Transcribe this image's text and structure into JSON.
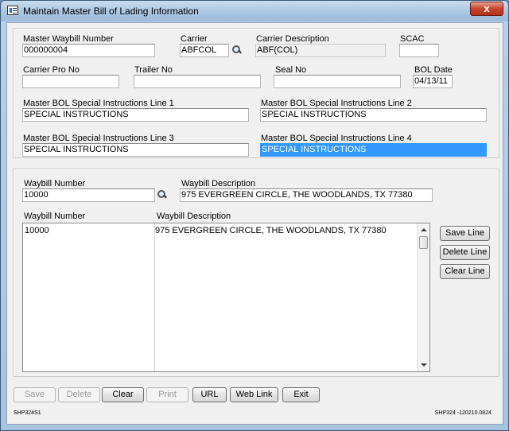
{
  "window": {
    "title": "Maintain Master Bill of Lading Information",
    "close": "x"
  },
  "header": {
    "master_waybill_label": "Master Waybill Number",
    "master_waybill_value": "000000004",
    "carrier_label": "Carrier",
    "carrier_value": "ABFCOL",
    "carrier_desc_label": "Carrier Description",
    "carrier_desc_value": "ABF(COL)",
    "scac_label": "SCAC",
    "scac_value": "",
    "carrier_pro_label": "Carrier Pro No",
    "carrier_pro_value": "",
    "trailer_label": "Trailer No",
    "trailer_value": "",
    "seal_label": "Seal No",
    "seal_value": "",
    "bol_date_label": "BOL Date",
    "bol_date_value": "04/13/11",
    "instr1_label": "Master BOL Special Instructions Line 1",
    "instr1_value": "SPECIAL INSTRUCTIONS",
    "instr2_label": "Master BOL Special Instructions Line 2",
    "instr2_value": "SPECIAL INSTRUCTIONS",
    "instr3_label": "Master BOL Special Instructions Line 3",
    "instr3_value": "SPECIAL INSTRUCTIONS",
    "instr4_label": "Master BOL Special Instructions Line 4",
    "instr4_value": "SPECIAL INSTRUCTIONS"
  },
  "detail": {
    "waybill_label": "Waybill Number",
    "waybill_value": "10000",
    "waybill_desc_label": "Waybill Description",
    "waybill_desc_value": "975 EVERGREEN CIRCLE, THE WOODLANDS, TX 77380",
    "columns": [
      "Waybill Number",
      "Waybill Description"
    ],
    "rows": [
      {
        "number": "10000",
        "description": "975 EVERGREEN CIRCLE, THE WOODLANDS, TX 77380"
      }
    ],
    "side_buttons": {
      "save_line": "Save Line",
      "delete_line": "Delete Line",
      "clear_line": "Clear Line"
    }
  },
  "toolbar": {
    "save": "Save",
    "delete": "Delete",
    "clear": "Clear",
    "print": "Print",
    "url": "URL",
    "web_link": "Web Link",
    "exit": "Exit"
  },
  "footer": {
    "left_code": "SHP324S1",
    "right_code": "SHP324 -120210.0824"
  }
}
